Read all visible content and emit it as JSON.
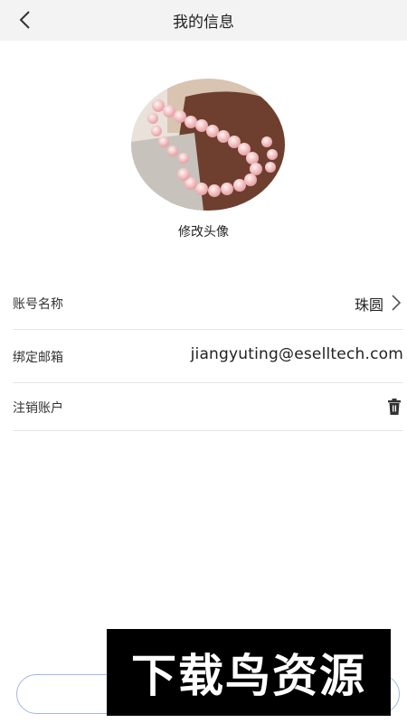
{
  "header": {
    "title": "我的信息",
    "back_icon": "chevron-left-icon"
  },
  "avatar": {
    "caption": "修改头像"
  },
  "rows": [
    {
      "label": "账号名称",
      "value": "珠圆",
      "icon": "chevron-right-icon"
    },
    {
      "label": "绑定邮箱",
      "value": "jiangyuting@eselltech.com"
    },
    {
      "label": "注销账户",
      "icon": "trash-icon"
    }
  ],
  "watermark": "下载鸟资源",
  "colors": {
    "header_bg": "#f3f3f3",
    "divider": "#e6e6e6",
    "button_border": "#9fb8e6"
  }
}
